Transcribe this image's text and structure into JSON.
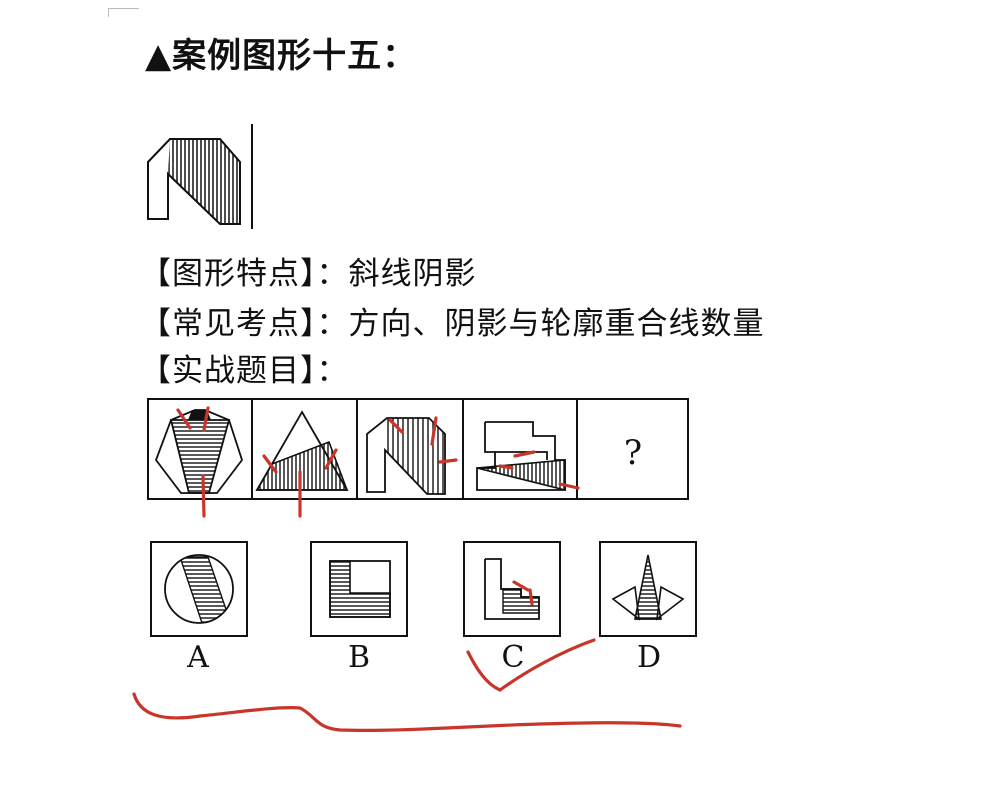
{
  "title": "▲案例图形十五：",
  "lines": {
    "feature": "【图形特点】：斜线阴影",
    "common": "【常见考点】：方向、阴影与轮廓重合线数量",
    "practice": "【实战题目】："
  },
  "sequence": {
    "unknown": "?"
  },
  "options": [
    {
      "label": "A"
    },
    {
      "label": "B"
    },
    {
      "label": "C"
    },
    {
      "label": "D"
    }
  ],
  "colors": {
    "ink": "#111111",
    "annotation": "#c8352a"
  }
}
